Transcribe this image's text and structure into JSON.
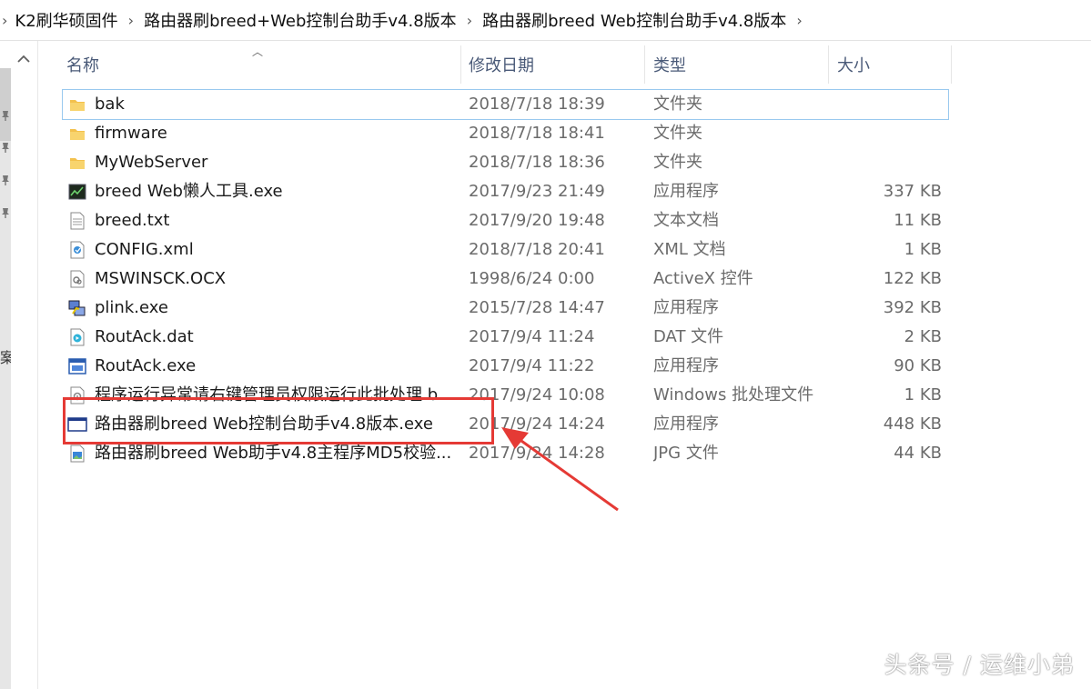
{
  "breadcrumb": {
    "items": [
      "K2刷华硕固件",
      "路由器刷breed+Web控制台助手v4.8版本",
      "路由器刷breed Web控制台助手v4.8版本"
    ]
  },
  "nav": {
    "partial_label": "案"
  },
  "columns": {
    "name": "名称",
    "date": "修改日期",
    "type": "类型",
    "size": "大小"
  },
  "files": [
    {
      "name": "bak",
      "date": "2018/7/18 18:39",
      "type": "文件夹",
      "size": "",
      "icon": "folder-icon"
    },
    {
      "name": "firmware",
      "date": "2018/7/18 18:41",
      "type": "文件夹",
      "size": "",
      "icon": "folder-icon"
    },
    {
      "name": "MyWebServer",
      "date": "2018/7/18 18:36",
      "type": "文件夹",
      "size": "",
      "icon": "folder-icon"
    },
    {
      "name": "breed Web懒人工具.exe",
      "date": "2017/9/23 21:49",
      "type": "应用程序",
      "size": "337 KB",
      "icon": "terminal-app-icon"
    },
    {
      "name": "breed.txt",
      "date": "2017/9/20 19:48",
      "type": "文本文档",
      "size": "11 KB",
      "icon": "text-file-icon"
    },
    {
      "name": "CONFIG.xml",
      "date": "2018/7/18 20:41",
      "type": "XML 文档",
      "size": "1 KB",
      "icon": "xml-file-icon"
    },
    {
      "name": "MSWINSCK.OCX",
      "date": "1998/6/24 0:00",
      "type": "ActiveX 控件",
      "size": "122 KB",
      "icon": "activex-file-icon"
    },
    {
      "name": "plink.exe",
      "date": "2015/7/28 14:47",
      "type": "应用程序",
      "size": "392 KB",
      "icon": "plink-app-icon"
    },
    {
      "name": "RoutAck.dat",
      "date": "2017/9/4 11:24",
      "type": "DAT 文件",
      "size": "2 KB",
      "icon": "media-file-icon"
    },
    {
      "name": "RoutAck.exe",
      "date": "2017/9/4 11:22",
      "type": "应用程序",
      "size": "90 KB",
      "icon": "window-app-icon"
    },
    {
      "name": "程序运行异常请右键管理员权限运行此批处理.b...",
      "date": "2017/9/24 10:08",
      "type": "Windows 批处理文件",
      "size": "1 KB",
      "icon": "batch-file-icon"
    },
    {
      "name": "路由器刷breed Web控制台助手v4.8版本.exe",
      "date": "2017/9/24 14:24",
      "type": "应用程序",
      "size": "448 KB",
      "icon": "window-app-icon"
    },
    {
      "name": "路由器刷breed Web助手v4.8主程序MD5校验...",
      "date": "2017/9/24 14:28",
      "type": "JPG 文件",
      "size": "44 KB",
      "icon": "image-file-icon"
    }
  ],
  "watermark": "头条号 / 运维小弟"
}
